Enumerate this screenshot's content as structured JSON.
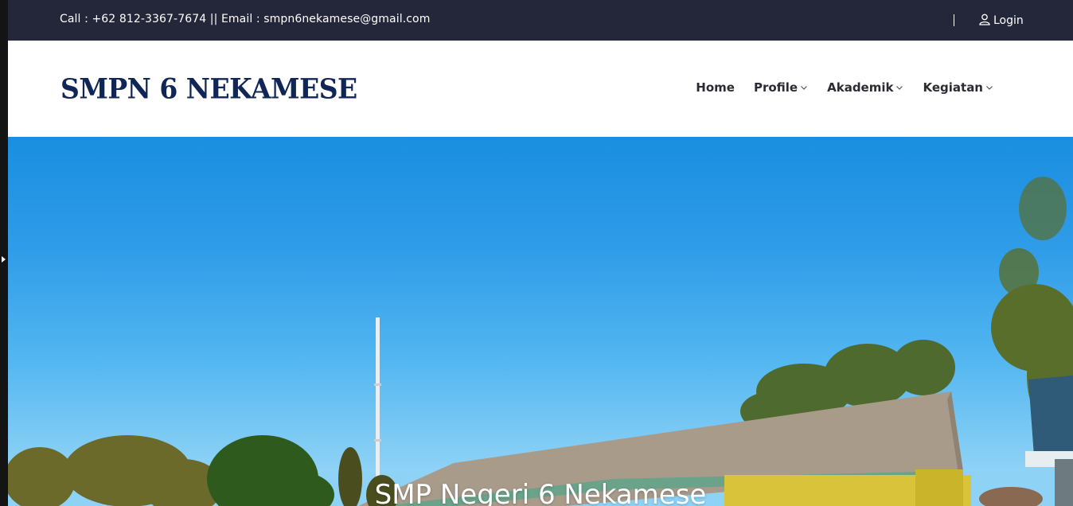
{
  "topbar": {
    "contact": "Call : +62 812-3367-7674 || Email : smpn6nekamese@gmail.com",
    "login_label": "Login",
    "login_icon": "user-icon"
  },
  "header": {
    "logo": "SMPN 6 NEKAMESE",
    "nav": [
      {
        "label": "Home",
        "has_dropdown": false
      },
      {
        "label": "Profile",
        "has_dropdown": true
      },
      {
        "label": "Akademik",
        "has_dropdown": true
      },
      {
        "label": "Kegiatan",
        "has_dropdown": true
      }
    ]
  },
  "hero": {
    "title": "SMP Negeri 6 Nekamese"
  },
  "colors": {
    "topbar_bg": "#24263a",
    "logo": "#0f2656",
    "nav_text": "#2b2b33",
    "sky": "#2f9ce8"
  }
}
